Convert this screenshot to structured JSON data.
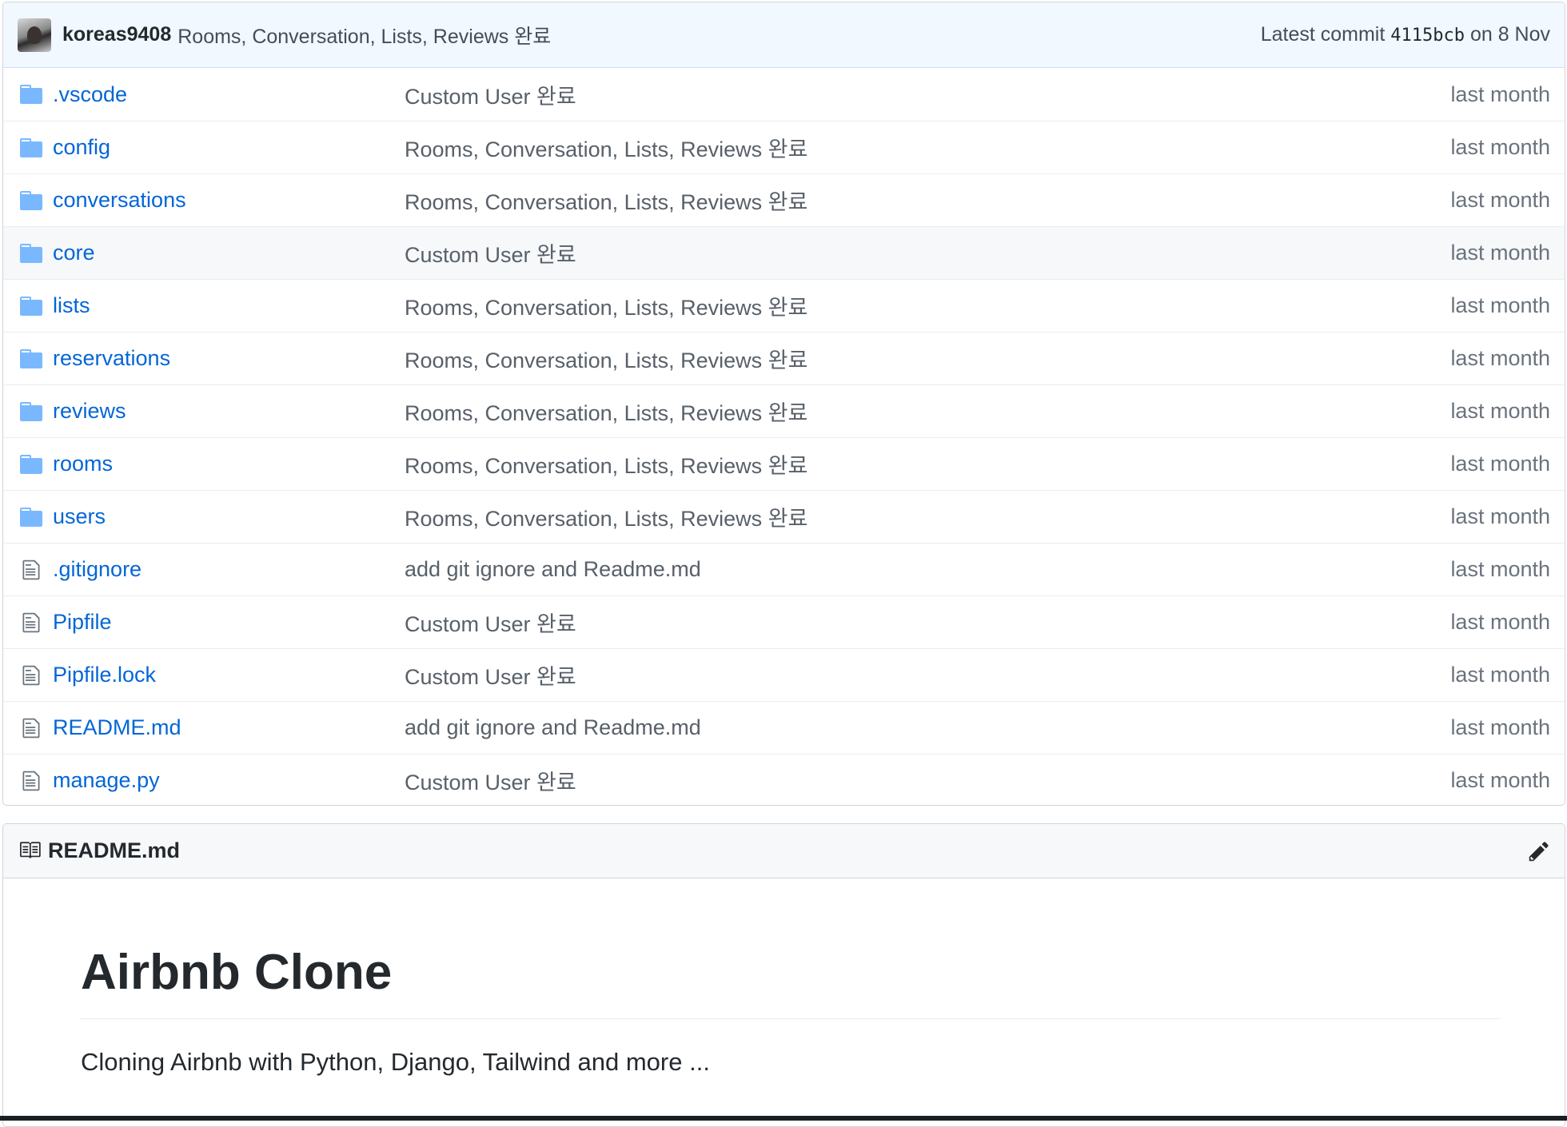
{
  "commit": {
    "author": "koreas9408",
    "message": "Rooms, Conversation, Lists, Reviews 완료",
    "latest_label": "Latest commit",
    "sha": "4115bcb",
    "date": "on 8 Nov"
  },
  "files": [
    {
      "type": "dir",
      "icon": "folder-icon",
      "name": ".vscode",
      "message": "Custom User 완료",
      "age": "last month"
    },
    {
      "type": "dir",
      "icon": "folder-icon",
      "name": "config",
      "message": "Rooms, Conversation, Lists, Reviews 완료",
      "age": "last month"
    },
    {
      "type": "dir",
      "icon": "folder-icon",
      "name": "conversations",
      "message": "Rooms, Conversation, Lists, Reviews 완료",
      "age": "last month"
    },
    {
      "type": "dir",
      "icon": "folder-icon",
      "name": "core",
      "message": "Custom User 완료",
      "age": "last month"
    },
    {
      "type": "dir",
      "icon": "folder-icon",
      "name": "lists",
      "message": "Rooms, Conversation, Lists, Reviews 완료",
      "age": "last month"
    },
    {
      "type": "dir",
      "icon": "folder-icon",
      "name": "reservations",
      "message": "Rooms, Conversation, Lists, Reviews 완료",
      "age": "last month"
    },
    {
      "type": "dir",
      "icon": "folder-icon",
      "name": "reviews",
      "message": "Rooms, Conversation, Lists, Reviews 완료",
      "age": "last month"
    },
    {
      "type": "dir",
      "icon": "folder-icon",
      "name": "rooms",
      "message": "Rooms, Conversation, Lists, Reviews 완료",
      "age": "last month"
    },
    {
      "type": "dir",
      "icon": "folder-icon",
      "name": "users",
      "message": "Rooms, Conversation, Lists, Reviews 완료",
      "age": "last month"
    },
    {
      "type": "file",
      "icon": "file-icon",
      "name": ".gitignore",
      "message": "add git ignore and Readme.md",
      "age": "last month"
    },
    {
      "type": "file",
      "icon": "file-icon",
      "name": "Pipfile",
      "message": "Custom User 완료",
      "age": "last month"
    },
    {
      "type": "file",
      "icon": "file-icon",
      "name": "Pipfile.lock",
      "message": "Custom User 완료",
      "age": "last month"
    },
    {
      "type": "file",
      "icon": "file-icon",
      "name": "README.md",
      "message": "add git ignore and Readme.md",
      "age": "last month"
    },
    {
      "type": "file",
      "icon": "file-icon",
      "name": "manage.py",
      "message": "Custom User 완료",
      "age": "last month"
    }
  ],
  "readme": {
    "icon": "book-icon",
    "title": "README.md",
    "edit_icon": "pencil-icon",
    "heading": "Airbnb Clone",
    "paragraph": "Cloning Airbnb with Python, Django, Tailwind and more ..."
  },
  "colors": {
    "link": "#0366d6",
    "folder": "#79b8ff",
    "commit_bar_bg": "#f1f8ff"
  }
}
